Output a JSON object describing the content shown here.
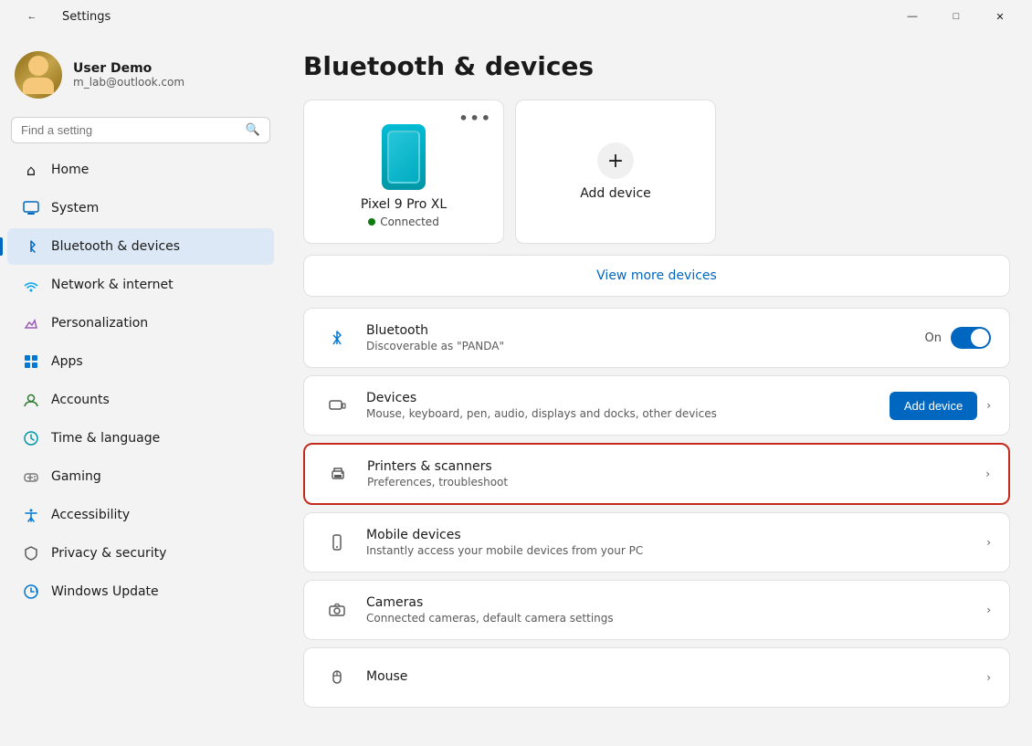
{
  "titleBar": {
    "title": "Settings",
    "back_btn": "←",
    "minimize_btn": "—",
    "maximize_btn": "□",
    "close_btn": "✕"
  },
  "sidebar": {
    "profile": {
      "name": "User Demo",
      "email": "m_lab@outlook.com"
    },
    "search_placeholder": "Find a setting",
    "nav_items": [
      {
        "id": "home",
        "label": "Home",
        "icon": "⌂"
      },
      {
        "id": "system",
        "label": "System",
        "icon": "💻"
      },
      {
        "id": "bluetooth",
        "label": "Bluetooth & devices",
        "icon": "⚡",
        "active": true
      },
      {
        "id": "network",
        "label": "Network & internet",
        "icon": "🌐"
      },
      {
        "id": "personalization",
        "label": "Personalization",
        "icon": "✏️"
      },
      {
        "id": "apps",
        "label": "Apps",
        "icon": "📦"
      },
      {
        "id": "accounts",
        "label": "Accounts",
        "icon": "👤"
      },
      {
        "id": "time",
        "label": "Time & language",
        "icon": "🌍"
      },
      {
        "id": "gaming",
        "label": "Gaming",
        "icon": "🎮"
      },
      {
        "id": "accessibility",
        "label": "Accessibility",
        "icon": "♿"
      },
      {
        "id": "privacy",
        "label": "Privacy & security",
        "icon": "🛡️"
      },
      {
        "id": "windows_update",
        "label": "Windows Update",
        "icon": "🔄"
      }
    ]
  },
  "main": {
    "page_title": "Bluetooth & devices",
    "devices": [
      {
        "name": "Pixel 9 Pro XL",
        "status": "Connected",
        "more": "•••"
      }
    ],
    "add_device_label": "Add device",
    "view_more_label": "View more devices",
    "bluetooth_section": {
      "title": "Bluetooth",
      "subtitle": "Discoverable as \"PANDA\"",
      "toggle_label": "On",
      "toggle_on": true
    },
    "settings_rows": [
      {
        "id": "devices",
        "title": "Devices",
        "subtitle": "Mouse, keyboard, pen, audio, displays and docks, other devices",
        "has_add_btn": true,
        "add_btn_label": "Add device",
        "highlighted": false
      },
      {
        "id": "printers",
        "title": "Printers & scanners",
        "subtitle": "Preferences, troubleshoot",
        "has_add_btn": false,
        "highlighted": true
      },
      {
        "id": "mobile",
        "title": "Mobile devices",
        "subtitle": "Instantly access your mobile devices from your PC",
        "has_add_btn": false,
        "highlighted": false
      },
      {
        "id": "cameras",
        "title": "Cameras",
        "subtitle": "Connected cameras, default camera settings",
        "has_add_btn": false,
        "highlighted": false
      },
      {
        "id": "mouse",
        "title": "Mouse",
        "subtitle": "",
        "has_add_btn": false,
        "highlighted": false
      }
    ]
  }
}
